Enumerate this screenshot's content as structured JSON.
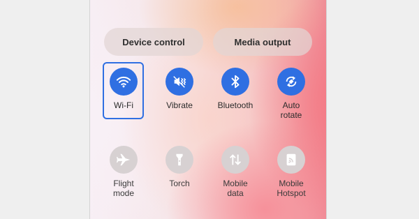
{
  "buttons": {
    "device_control": "Device control",
    "media_output": "Media output"
  },
  "tiles": [
    {
      "label": "Wi-Fi",
      "icon": "wifi-icon",
      "state": "on"
    },
    {
      "label": "Vibrate",
      "icon": "vibrate-icon",
      "state": "on"
    },
    {
      "label": "Bluetooth",
      "icon": "bluetooth-icon",
      "state": "on"
    },
    {
      "label": "Auto\nrotate",
      "icon": "auto-rotate-icon",
      "state": "on"
    },
    {
      "label": "Flight\nmode",
      "icon": "airplane-icon",
      "state": "off"
    },
    {
      "label": "Torch",
      "icon": "flashlight-icon",
      "state": "off"
    },
    {
      "label": "Mobile\ndata",
      "icon": "mobile-data-icon",
      "state": "off"
    },
    {
      "label": "Mobile\nHotspot",
      "icon": "hotspot-icon",
      "state": "off"
    }
  ],
  "colors": {
    "accent": "#2f6fe2",
    "tile_off": "#d7d1d2",
    "selection_outline": "#2f6fe2"
  }
}
